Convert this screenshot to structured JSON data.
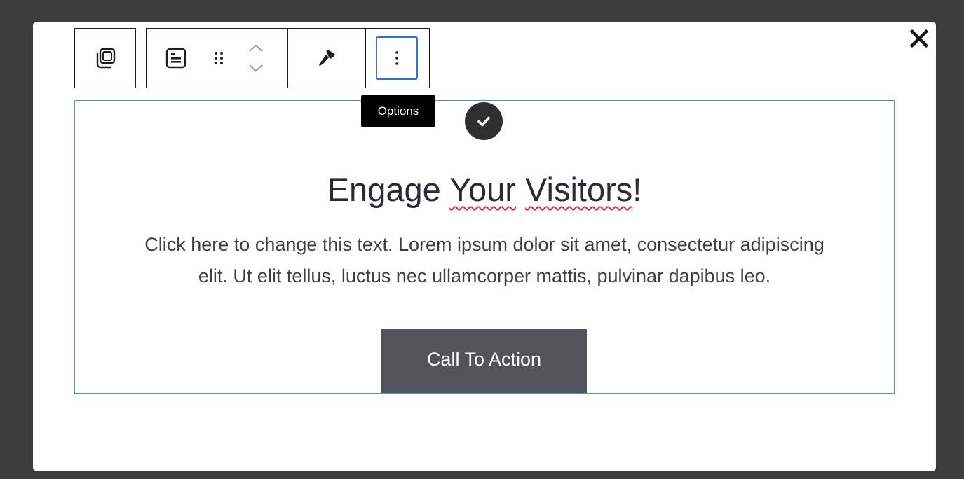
{
  "toolbar": {
    "icons": [
      "copy-icon",
      "block-type-icon",
      "drag-handle-icon",
      "chevron-up-icon",
      "chevron-down-icon",
      "paintbrush-icon",
      "more-vertical-icon"
    ],
    "tooltip": "Options"
  },
  "close_icon": "close-icon",
  "block": {
    "badge_icon": "checkmark-icon",
    "heading_part1": "Engage ",
    "heading_word_your": "Your",
    "heading_space": " ",
    "heading_word_visitors": "Visitors",
    "heading_end": "!",
    "body_line1": "Click here to change this text. Lorem ipsum dolor sit amet, consectetur adipiscing",
    "body_line2": "elit. Ut elit tellus, luctus nec ullamcorper mattis, pulvinar dapibus leo.",
    "cta_label": "Call To Action"
  },
  "colors": {
    "backdrop": "#3c3c3c",
    "accent_blue": "#3a6fd0",
    "cta_bg": "#54535c",
    "spellcheck_red": "#e0242c"
  }
}
